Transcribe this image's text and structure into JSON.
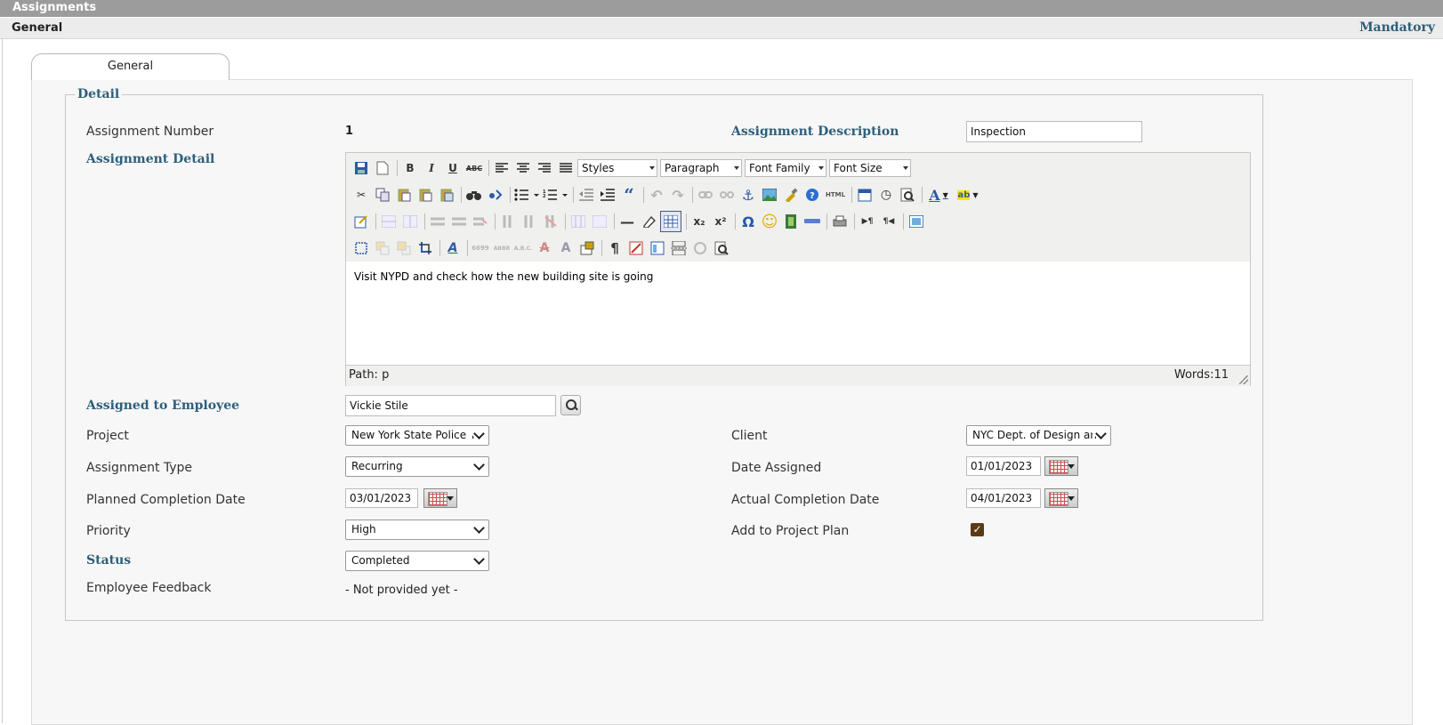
{
  "window": {
    "title": "Assignments"
  },
  "section": {
    "left": "General",
    "right": "Mandatory"
  },
  "tabs": [
    {
      "label": "General"
    }
  ],
  "detail": {
    "legend": "Detail"
  },
  "fields": {
    "assignment_number": {
      "label": "Assignment Number",
      "value": "1"
    },
    "assignment_description": {
      "label": "Assignment Description",
      "value": "Inspection"
    },
    "assignment_detail": {
      "label": "Assignment Detail"
    },
    "assigned_to_employee": {
      "label": "Assigned to Employee",
      "value": "Vickie Stile"
    },
    "project": {
      "label": "Project",
      "value": "New York State Police T"
    },
    "client": {
      "label": "Client",
      "value": "NYC Dept. of Design an"
    },
    "assignment_type": {
      "label": "Assignment Type",
      "value": "Recurring"
    },
    "date_assigned": {
      "label": "Date Assigned",
      "value": "01/01/2023"
    },
    "planned_completion_date": {
      "label": "Planned Completion Date",
      "value": "03/01/2023"
    },
    "actual_completion_date": {
      "label": "Actual Completion Date",
      "value": "04/01/2023"
    },
    "priority": {
      "label": "Priority",
      "value": "High"
    },
    "add_to_project_plan": {
      "label": "Add to Project Plan",
      "checked": true
    },
    "status": {
      "label": "Status",
      "value": "Completed"
    },
    "employee_feedback": {
      "label": "Employee Feedback",
      "value": "- Not provided yet -"
    }
  },
  "editor": {
    "styles_label": "Styles",
    "paragraph_label": "Paragraph",
    "font_family_label": "Font Family",
    "font_size_label": "Font Size",
    "content": "Visit NYPD and check how the new building site is going",
    "path": "Path: p",
    "words": "Words:11",
    "glyphs": {
      "bold": "B",
      "italic": "I",
      "underline": "U",
      "strike": "ABC",
      "blockquote": "“",
      "html": "HTML",
      "hr": "—",
      "sub": "x₂",
      "sup": "x²",
      "omega": "Ω",
      "smiley": "☺",
      "pilcrow": "¶",
      "anchor": "⚓",
      "help": "?",
      "clock": "◷",
      "font_color": "A",
      "highlight": "ab",
      "style_a": "A",
      "undo": "↶",
      "redo": "↷",
      "ltr": "▶¶",
      "rtl": "¶◀",
      "cut": "✂",
      "find": "⚲",
      "print": "⎙",
      "abbr": "ABBR",
      "acronym": "A.B.C.",
      "cite": "6699",
      "del": "A",
      "ins": "A"
    }
  }
}
